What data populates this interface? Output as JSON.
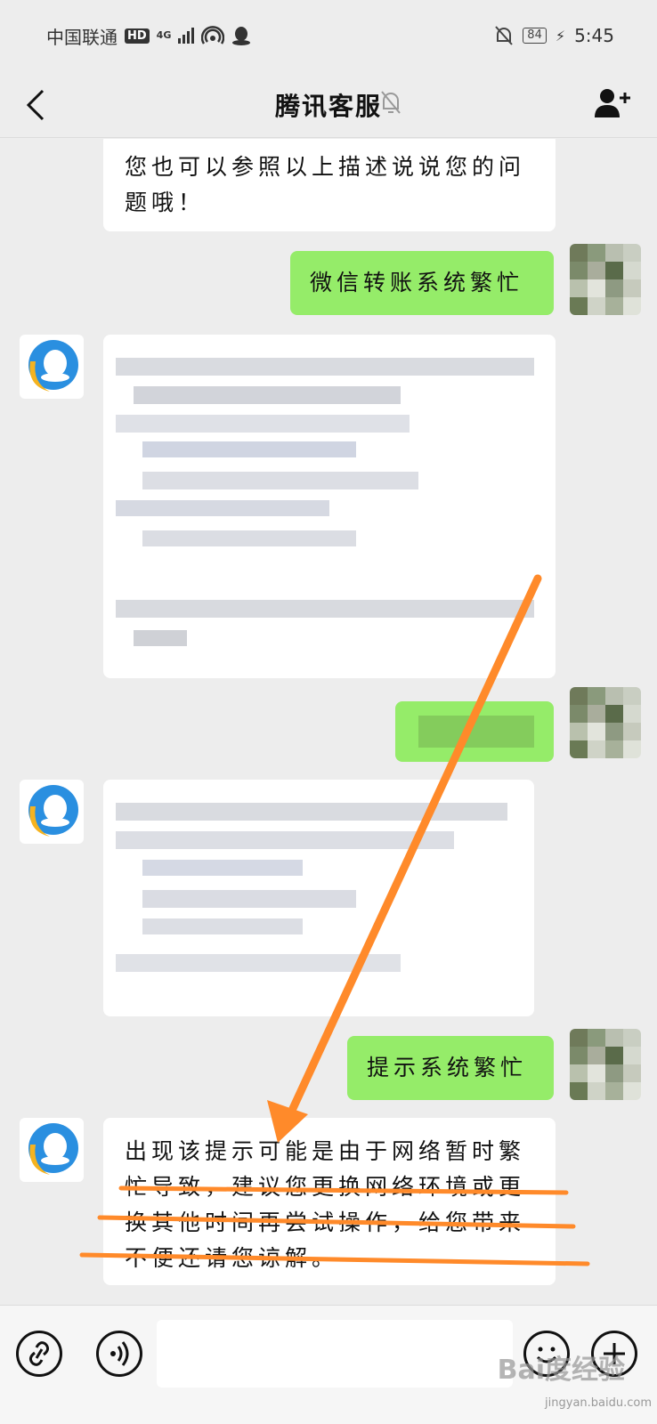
{
  "status_bar": {
    "carrier": "中国联通",
    "hd": "HD",
    "network": "4G",
    "battery": "84",
    "time": "5:45"
  },
  "nav": {
    "title": "腾讯客服"
  },
  "messages": [
    {
      "from": "bot",
      "text": "您也可以参照以上描述说说您的问题哦！"
    },
    {
      "from": "user",
      "text": "微信转账系统繁忙"
    },
    {
      "from": "bot",
      "text": "",
      "pixelated": true
    },
    {
      "from": "user",
      "text": "",
      "pixelated": true
    },
    {
      "from": "bot",
      "text": "",
      "pixelated": true
    },
    {
      "from": "user",
      "text": "提示系统繁忙"
    },
    {
      "from": "bot",
      "text": "出现该提示可能是由于网络暂时繁忙导致，建议您更换网络环境或更换其他时间再尝试操作，给您带来不便还请您谅解。"
    }
  ],
  "input": {
    "value": ""
  },
  "watermark": {
    "logo": "Bai度经验",
    "site": "jingyan.baidu.com"
  },
  "colors": {
    "background": "#ededed",
    "outgoing_bubble": "#95ec69",
    "incoming_bubble": "#ffffff",
    "annotation": "#ff8a2a"
  },
  "icons": {
    "back": "chevron-left-icon",
    "mute": "bell-off-icon",
    "add_contact": "add-user-icon",
    "link": "link-icon",
    "voice": "voice-icon",
    "emoji": "emoji-icon",
    "more": "plus-icon",
    "bot_avatar": "qq-bubble-icon"
  }
}
